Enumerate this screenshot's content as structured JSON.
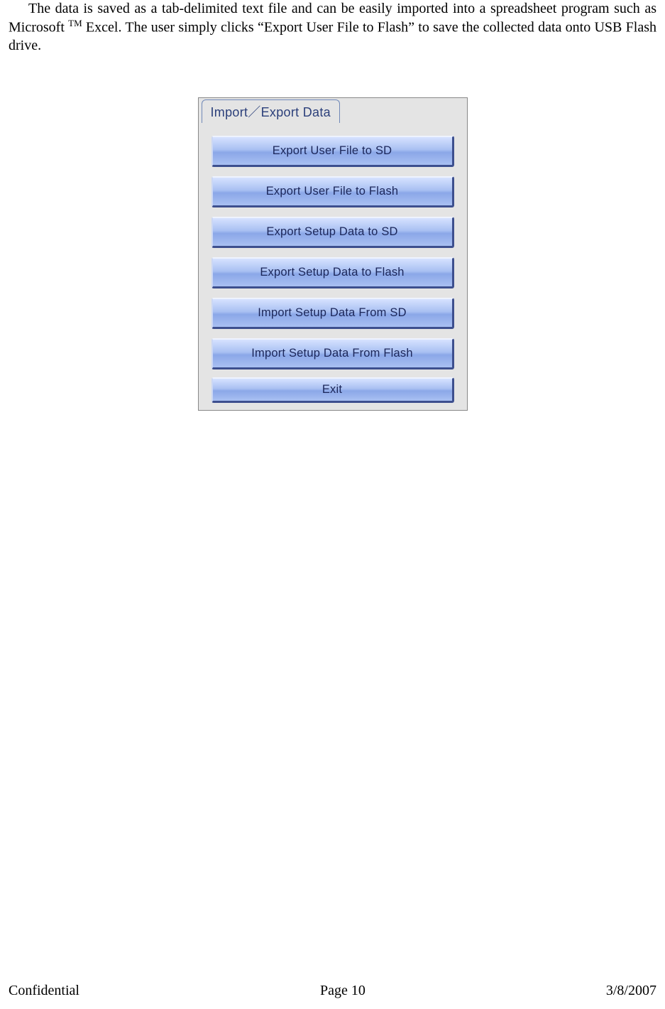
{
  "paragraph": {
    "pre": "The data is saved as a tab-delimited text file and can be easily imported into a spreadsheet program such as Microsoft ",
    "tm": "TM",
    "post": " Excel. The user simply clicks “Export User File to Flash” to save the collected data onto USB Flash drive."
  },
  "panel": {
    "tab_label": "Import／Export Data",
    "buttons": [
      "Export User File to SD",
      "Export User File to Flash",
      "Export Setup Data to SD",
      "Export Setup Data to Flash",
      "Import Setup Data From SD",
      "Import Setup Data From Flash"
    ],
    "exit_label": "Exit"
  },
  "footer": {
    "left": "Confidential",
    "center": "Page 10",
    "right": "3/8/2007"
  }
}
